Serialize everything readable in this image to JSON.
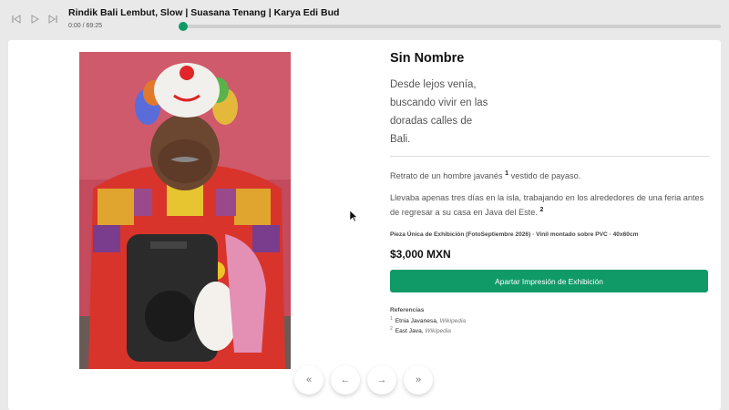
{
  "player": {
    "title": "Rindik Bali Lembut, Slow | Suasana Tenang | Karya Edi Bud",
    "time": "0:00 / 69:25",
    "progress": 0.0,
    "controls": [
      "skip-back-icon",
      "play-icon",
      "skip-forward-icon"
    ]
  },
  "artwork": {
    "title": "Sin Nombre",
    "poem": [
      "Desde lejos venía,",
      "buscando vivir en las",
      "doradas calles de",
      "Bali."
    ],
    "description1_pre": "Retrato de un hombre javanés",
    "description1_ref": "1",
    "description1_post": "vestido de payaso.",
    "description2_pre": "Llevaba apenas tres días en la isla, trabajando en los alrededores de una feria antes de regresar a su casa en Java del Este.",
    "description2_ref": "2",
    "edition": "Pieza Única de Exhibición (FotoSeptiembre 2026) · Vinil montado sobre PVC · 40x60cm",
    "price": "$3,000 MXN",
    "reserve_label": "Apartar Impresión de Exhibición"
  },
  "references": {
    "heading": "Referencias",
    "items": [
      {
        "num": "1",
        "label": "Etnia Javanesa",
        "source": "Wikipedia"
      },
      {
        "num": "2",
        "label": "East Java",
        "source": "Wikipedia"
      }
    ]
  },
  "navigation": {
    "first": "«",
    "prev": "←",
    "next": "→",
    "last": "»"
  },
  "colors": {
    "accent": "#0f9a68",
    "background": "#e9e9e9"
  }
}
